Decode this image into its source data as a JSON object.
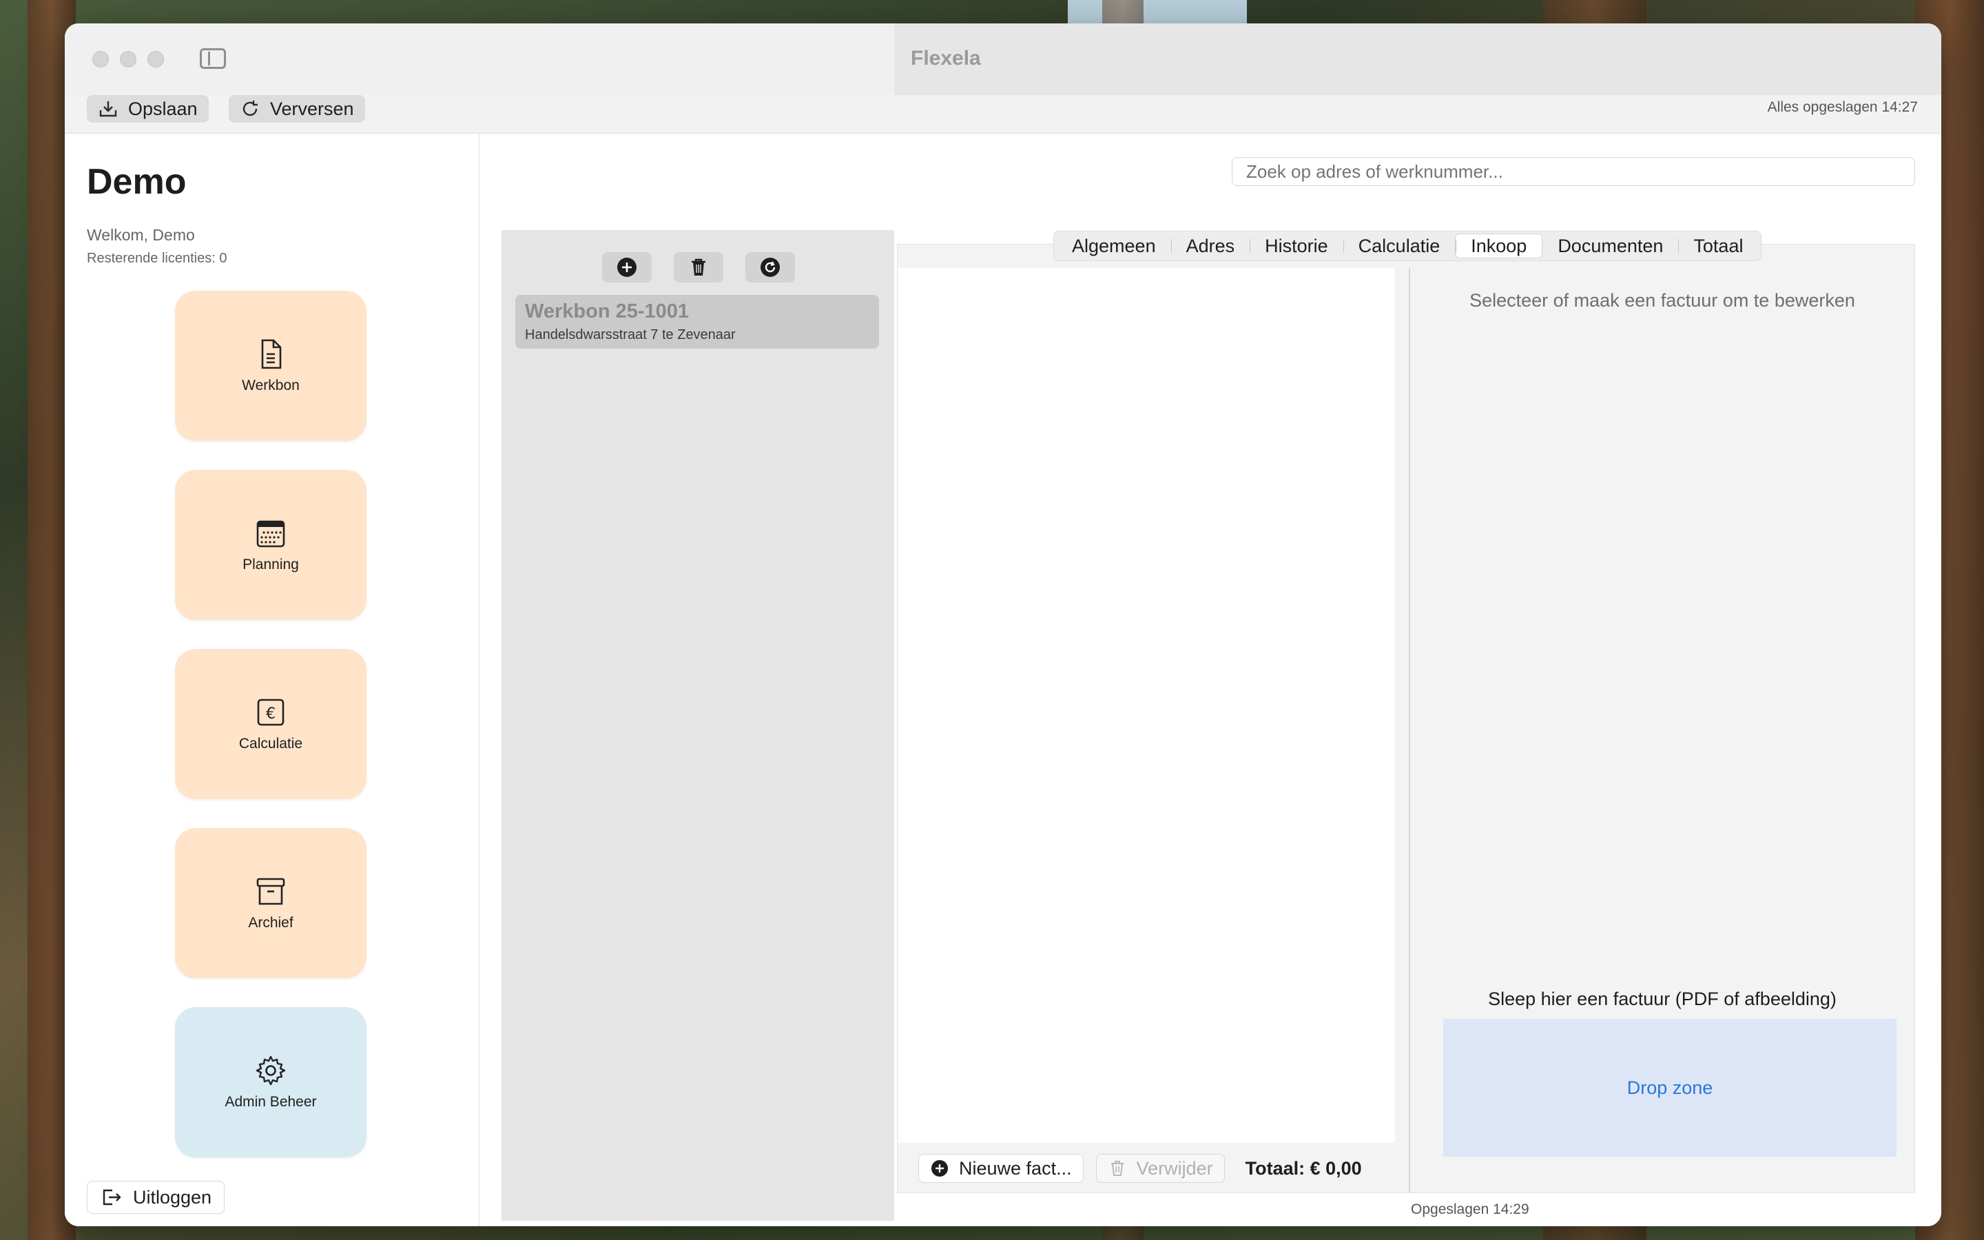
{
  "window": {
    "title": "Flexela"
  },
  "toolbar": {
    "save_label": "Opslaan",
    "refresh_label": "Verversen",
    "status": "Alles opgeslagen 14:27"
  },
  "sidebar": {
    "user_name": "Demo",
    "welcome": "Welkom, Demo",
    "licenses": "Resterende licenties: 0",
    "tiles": [
      {
        "label": "Werkbon",
        "icon": "document-icon"
      },
      {
        "label": "Planning",
        "icon": "calendar-icon"
      },
      {
        "label": "Calculatie",
        "icon": "euro-icon"
      },
      {
        "label": "Archief",
        "icon": "archive-icon"
      },
      {
        "label": "Admin Beheer",
        "icon": "gear-icon"
      }
    ],
    "logout_label": "Uitloggen"
  },
  "search": {
    "placeholder": "Zoek op adres of werknummer..."
  },
  "worklist": {
    "items": [
      {
        "title": "Werkbon 25-1001",
        "subtitle": "Handelsdwarsstraat 7 te Zevenaar"
      }
    ]
  },
  "tabs": [
    "Algemeen",
    "Adres",
    "Historie",
    "Calculatie",
    "Inkoop",
    "Documenten",
    "Totaal"
  ],
  "active_tab": "Inkoop",
  "detail": {
    "select_message": "Selecteer of maak een factuur om te bewerken",
    "drop_title": "Sleep hier een factuur (PDF of afbeelding)",
    "drop_zone": "Drop zone",
    "new_invoice_label": "Nieuwe fact...",
    "delete_label": "Verwijder",
    "total_label": "Totaal: € 0,00",
    "saved_status": "Opgeslagen 14:29"
  },
  "colors": {
    "tile_bg": "#ffe4ca",
    "admin_tile_bg": "#d8eaf2",
    "drop_zone_bg": "#dde6f6",
    "drop_zone_text": "#2a78d6"
  }
}
